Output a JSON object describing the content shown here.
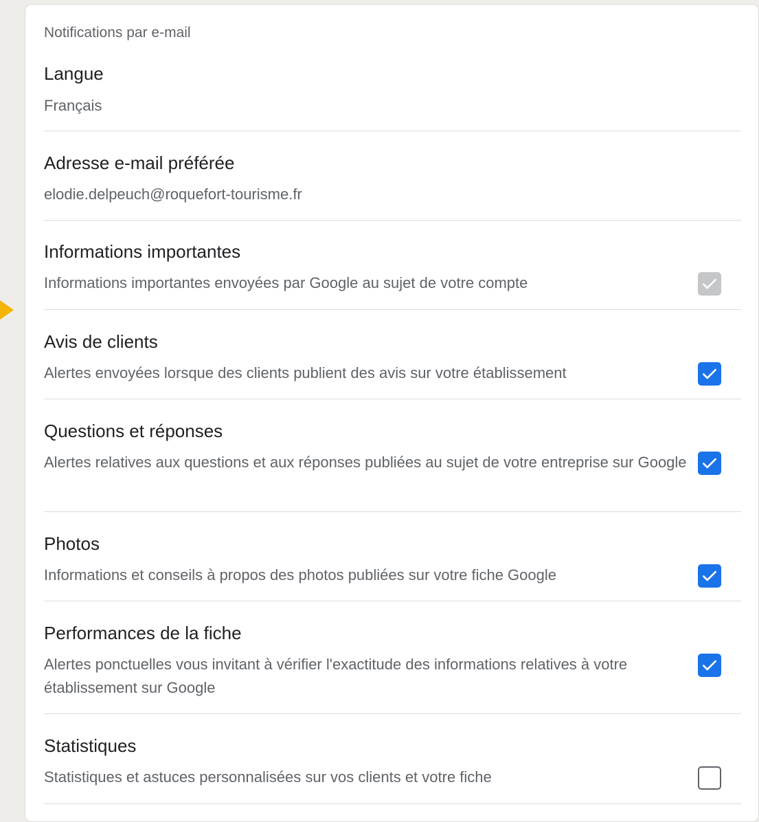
{
  "colors": {
    "checked": "#1a73e8",
    "disabled": "#c4c6c8",
    "accent_tab": "#f4b400"
  },
  "card_title": "Notifications par e-mail",
  "settings": [
    {
      "label": "Langue",
      "value": "Français"
    },
    {
      "label": "Adresse e-mail préférée",
      "value": "elodie.delpeuch@roquefort-tourisme.fr"
    },
    {
      "label": "Informations importantes",
      "description": "Informations importantes envoyées par Google au sujet de votre compte",
      "state": "checked-disabled"
    },
    {
      "label": "Avis de clients",
      "description": "Alertes envoyées lorsque des clients publient des avis sur votre établissement",
      "state": "checked"
    },
    {
      "label": "Questions et réponses",
      "description": "Alertes relatives aux questions et aux réponses publiées au sujet de votre entreprise sur Google",
      "state": "checked"
    },
    {
      "label": "Photos",
      "description": "Informations et conseils à propos des photos publiées sur votre fiche Google",
      "state": "checked"
    },
    {
      "label": "Performances de la fiche",
      "description": "Alertes ponctuelles vous invitant à vérifier l'exactitude des informations relatives à votre établissement sur Google",
      "state": "checked"
    },
    {
      "label": "Statistiques",
      "description": "Statistiques et astuces personnalisées sur vos clients et votre fiche",
      "state": "unchecked"
    }
  ]
}
